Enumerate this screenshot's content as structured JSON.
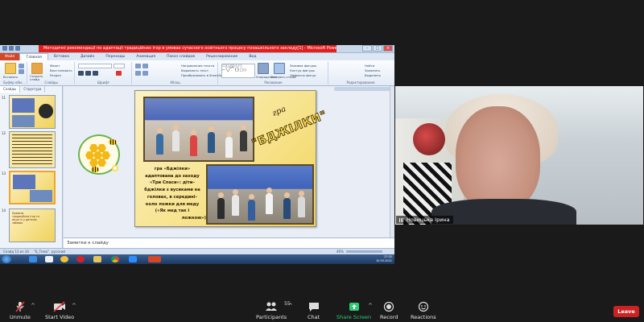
{
  "powerpoint": {
    "window_title": "Методичні рекомендації по адаптації традиційних ігор в умовах сучасного освітнього процесу позашкільного закладу[1] - Microsoft PowerPoint (Сбой активации продукта)",
    "tabs": [
      "Файл",
      "Главная",
      "Вставка",
      "Дизайн",
      "Переходы",
      "Анимация",
      "Показ слайдов",
      "Рецензирование",
      "Вид"
    ],
    "active_tab": "Главная",
    "ribbon_groups": [
      "Буфер обм...",
      "Слайды",
      "Шрифт",
      "Абзац",
      "Рисование",
      "Редактирование"
    ],
    "ribbon_small": {
      "insert": "Вставить",
      "create_slide": "Создать слайд",
      "layout": "Макет",
      "restore": "Восстановить",
      "section": "Раздел",
      "text_direction": "Направление текста",
      "align_text": "Выровнять текст",
      "convert_smartart": "Преобразовать в SmartArt",
      "arrange": "Упорядочить",
      "quick_styles": "Экспресс-стили",
      "shape_fill": "Заливка фигуры",
      "shape_outline": "Контур фигуры",
      "shape_effects": "Эффекты фигур",
      "find": "Найти",
      "replace": "Заменить",
      "select": "Выделить"
    },
    "side_tabs": [
      "Слайды",
      "Структура"
    ],
    "thumb_numbers": [
      "11",
      "12",
      "13",
      "14"
    ],
    "thumb14_text": "Правила традиційних ігор та місце їх у дитячих забавах",
    "notes_label": "Заметки к слайду",
    "status": {
      "slide": "Слайд 13 из 34",
      "theme": "\"Б_Тема\"",
      "lang": "русский",
      "zoom": "46%"
    },
    "clock": {
      "time": "17:32",
      "date": "10.03.2021"
    },
    "slide": {
      "gra": "гра",
      "title": "\"БДЖІЛКИ\"",
      "text_lines": [
        "гра «Бджілки»",
        "адаптована до заходу",
        "«Три Спаси»: діти–",
        "бджілки з вусиками на",
        "головах, в середині–",
        "коло ложки для меду",
        "(«Як мед так і",
        "ложкою»)"
      ]
    }
  },
  "video": {
    "participant_name": "Новицька Ірина"
  },
  "toolbar": {
    "unmute": "Unmute",
    "start_video": "Start Video",
    "participants": "Participants",
    "participants_count": "55",
    "chat": "Chat",
    "share_screen": "Share Screen",
    "record": "Record",
    "reactions": "Reactions",
    "leave": "Leave"
  },
  "colors": {
    "share_green": "#2ecc71",
    "leave_red": "#cc2222",
    "ppt_title_red": "#e11f1f"
  }
}
